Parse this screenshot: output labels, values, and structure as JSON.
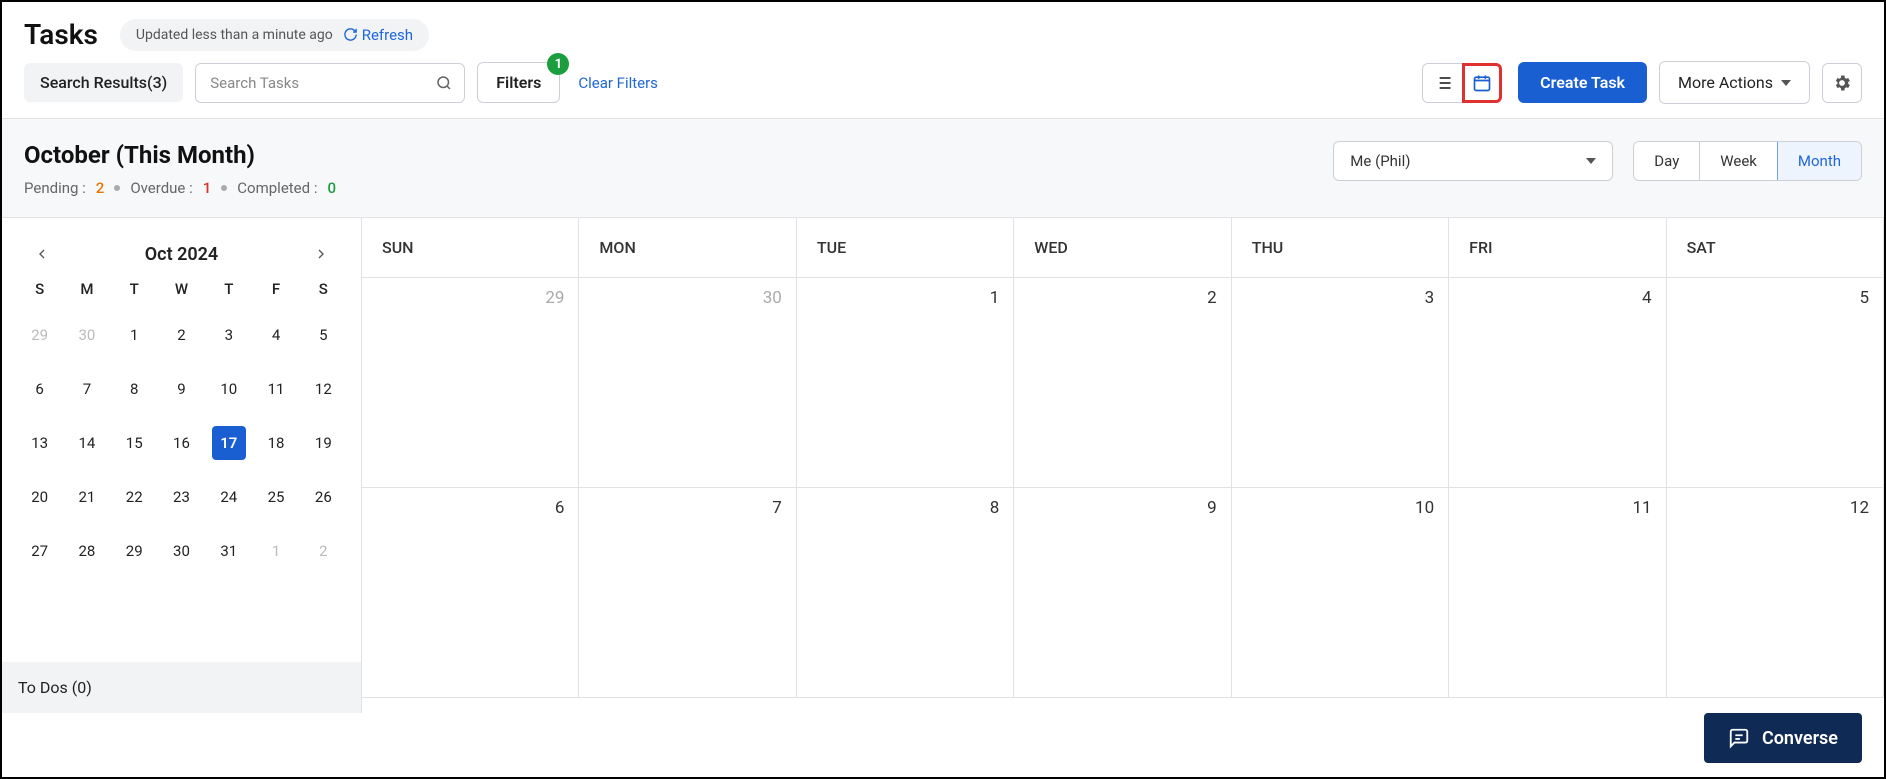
{
  "header": {
    "title": "Tasks",
    "updated_text": "Updated less than a minute ago",
    "refresh_label": "Refresh"
  },
  "toolbar": {
    "search_results_label": "Search Results(3)",
    "search_placeholder": "Search Tasks",
    "filters_label": "Filters",
    "filters_badge": "1",
    "clear_filters_label": "Clear Filters",
    "create_task_label": "Create Task",
    "more_actions_label": "More Actions"
  },
  "subheader": {
    "month_title": "October (This Month)",
    "pending_label": "Pending :",
    "pending_count": "2",
    "overdue_label": "Overdue :",
    "overdue_count": "1",
    "completed_label": "Completed :",
    "completed_count": "0",
    "user_selected": "Me (Phil)",
    "range": {
      "day": "Day",
      "week": "Week",
      "month": "Month"
    }
  },
  "mini_cal": {
    "label": "Oct 2024",
    "dow": [
      "S",
      "M",
      "T",
      "W",
      "T",
      "F",
      "S"
    ],
    "days": [
      {
        "n": "29",
        "faded": true
      },
      {
        "n": "30",
        "faded": true
      },
      {
        "n": "1"
      },
      {
        "n": "2"
      },
      {
        "n": "3"
      },
      {
        "n": "4"
      },
      {
        "n": "5"
      },
      {
        "n": "6"
      },
      {
        "n": "7"
      },
      {
        "n": "8"
      },
      {
        "n": "9"
      },
      {
        "n": "10"
      },
      {
        "n": "11"
      },
      {
        "n": "12"
      },
      {
        "n": "13"
      },
      {
        "n": "14"
      },
      {
        "n": "15"
      },
      {
        "n": "16"
      },
      {
        "n": "17",
        "today": true
      },
      {
        "n": "18"
      },
      {
        "n": "19"
      },
      {
        "n": "20"
      },
      {
        "n": "21"
      },
      {
        "n": "22"
      },
      {
        "n": "23"
      },
      {
        "n": "24"
      },
      {
        "n": "25"
      },
      {
        "n": "26"
      },
      {
        "n": "27"
      },
      {
        "n": "28"
      },
      {
        "n": "29"
      },
      {
        "n": "30"
      },
      {
        "n": "31"
      },
      {
        "n": "1",
        "faded": true
      },
      {
        "n": "2",
        "faded": true
      }
    ],
    "todos_label": "To Dos (0)"
  },
  "big_cal": {
    "dow": [
      "SUN",
      "MON",
      "TUE",
      "WED",
      "THU",
      "FRI",
      "SAT"
    ],
    "cells": [
      {
        "n": "29",
        "faded": true
      },
      {
        "n": "30",
        "faded": true
      },
      {
        "n": "1"
      },
      {
        "n": "2"
      },
      {
        "n": "3"
      },
      {
        "n": "4"
      },
      {
        "n": "5"
      },
      {
        "n": "6"
      },
      {
        "n": "7"
      },
      {
        "n": "8"
      },
      {
        "n": "9"
      },
      {
        "n": "10"
      },
      {
        "n": "11"
      },
      {
        "n": "12"
      }
    ]
  },
  "converse_label": "Converse"
}
